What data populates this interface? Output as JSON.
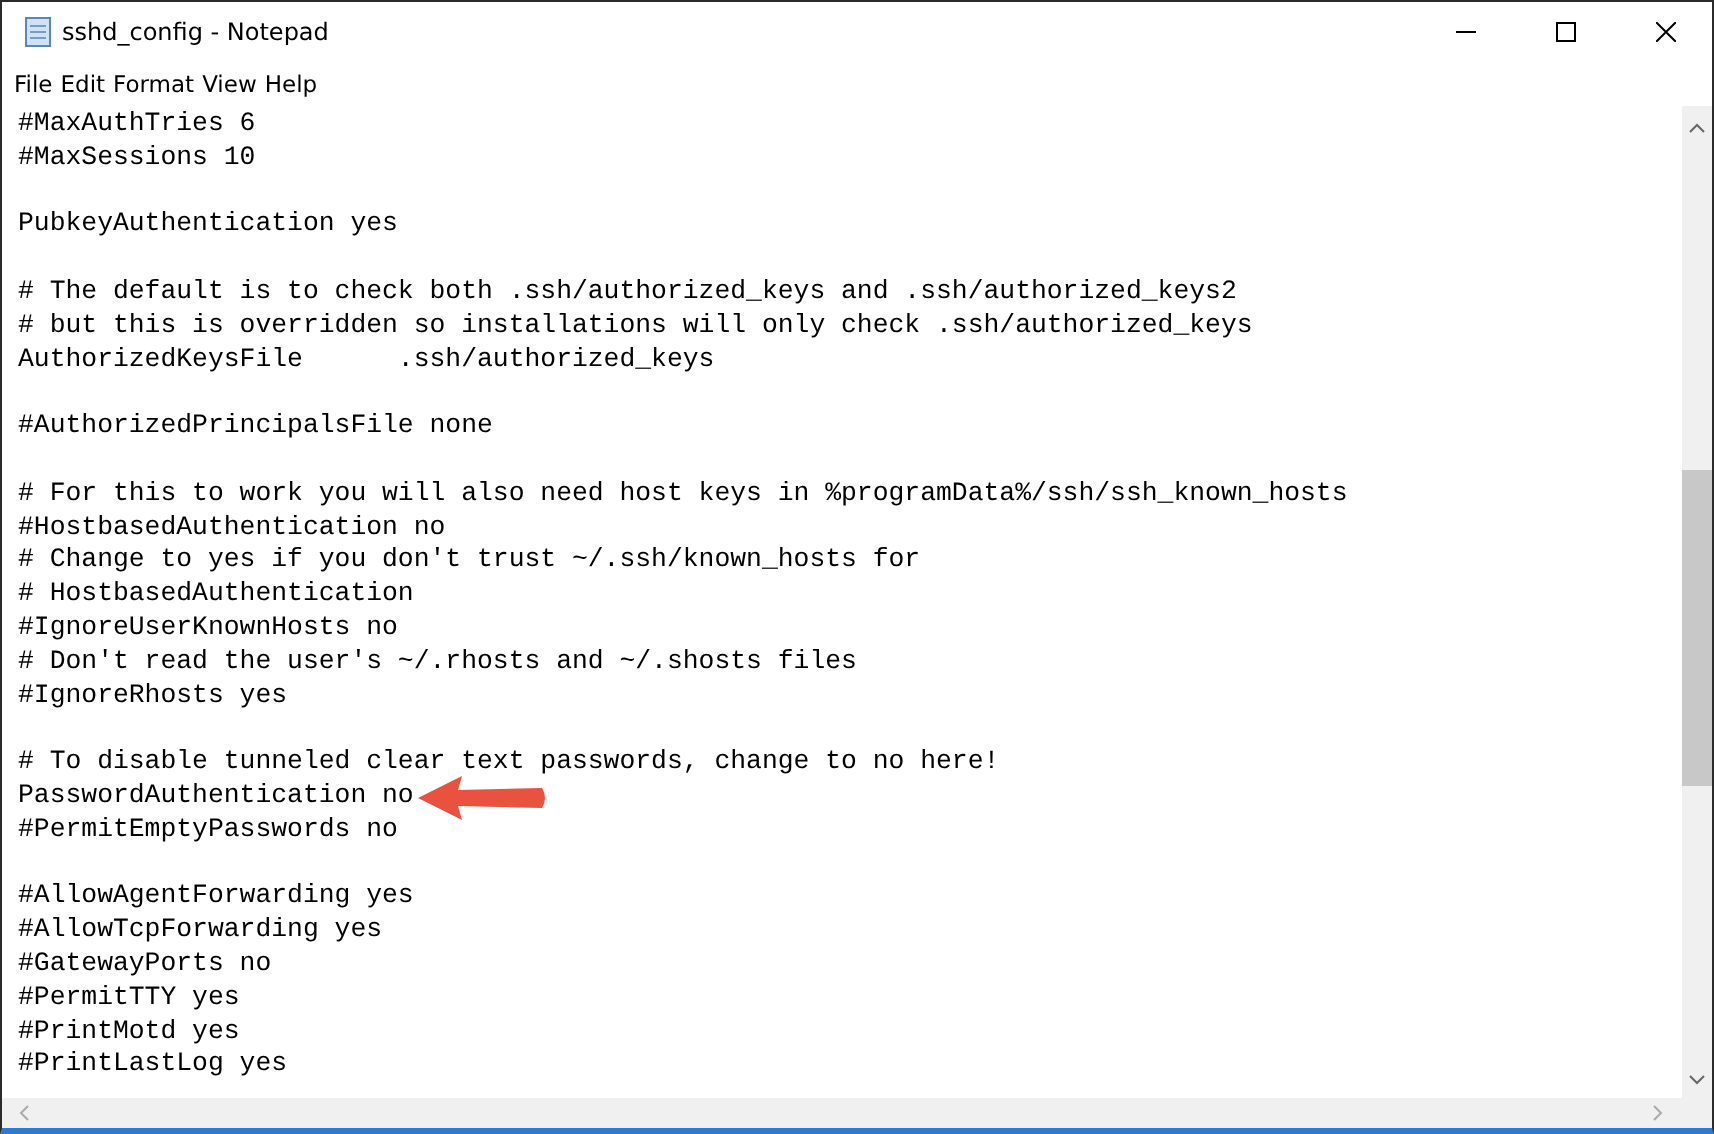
{
  "window": {
    "title": "sshd_config - Notepad"
  },
  "menu": [
    "File",
    "Edit",
    "Format",
    "View",
    "Help"
  ],
  "editor": {
    "blocks": [
      [
        "#MaxAuthTries 6",
        "#MaxSessions 10"
      ],
      [
        "PubkeyAuthentication yes"
      ],
      [
        "# The default is to check both .ssh/authorized_keys and .ssh/authorized_keys2",
        "# but this is overridden so installations will only check .ssh/authorized_keys",
        "AuthorizedKeysFile      .ssh/authorized_keys"
      ],
      [
        "#AuthorizedPrincipalsFile none"
      ],
      [
        "# For this to work you will also need host keys in %programData%/ssh/ssh_known_hosts",
        "#HostbasedAuthentication no",
        "# Change to yes if you don't trust ~/.ssh/known_hosts for",
        "# HostbasedAuthentication",
        "#IgnoreUserKnownHosts no",
        "# Don't read the user's ~/.rhosts and ~/.shosts files",
        "#IgnoreRhosts yes"
      ],
      [
        "# To disable tunneled clear text passwords, change to no here!",
        "PasswordAuthentication no",
        "#PermitEmptyPasswords no"
      ],
      [
        "#AllowAgentForwarding yes",
        "#AllowTcpForwarding yes",
        "#GatewayPorts no",
        "#PermitTTY yes",
        "#PrintMotd yes",
        "#PrintLastLog yes"
      ]
    ]
  }
}
